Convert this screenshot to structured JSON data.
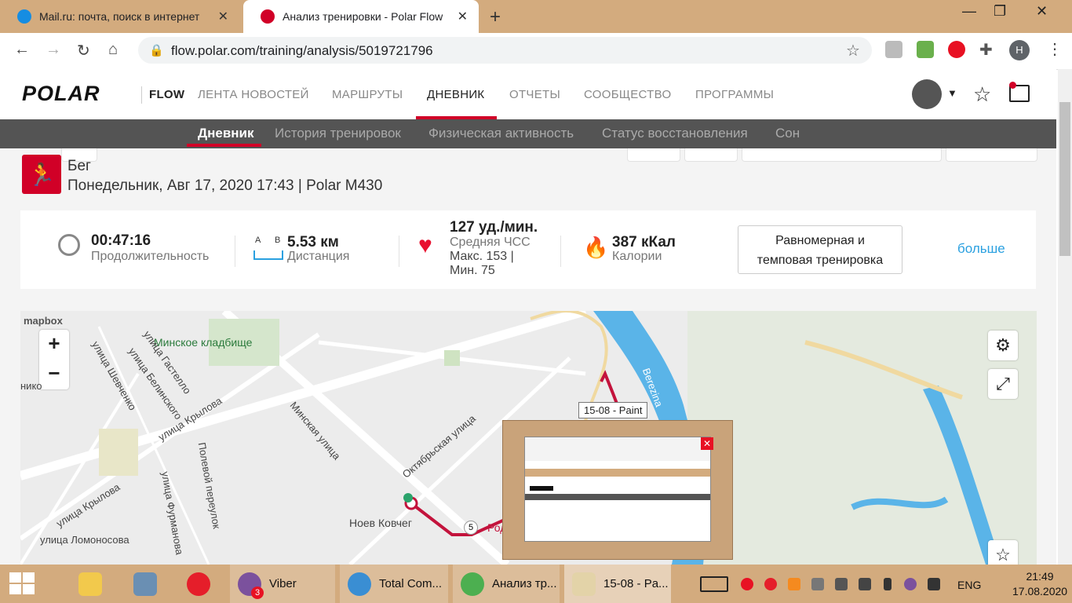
{
  "browser": {
    "tabs": [
      {
        "title": "Mail.ru: почта, поиск в интернет",
        "active": false
      },
      {
        "title": "Анализ тренировки - Polar Flow",
        "active": true
      }
    ],
    "url": "flow.polar.com/training/analysis/5019721796",
    "profile_initial": "Н"
  },
  "polar": {
    "logo": "POLAR",
    "nav": [
      "FLOW",
      "ЛЕНТА НОВОСТЕЙ",
      "МАРШРУТЫ",
      "ДНЕВНИК",
      "ОТЧЕТЫ",
      "СООБЩЕСТВО",
      "ПРОГРАММЫ"
    ],
    "active_nav": "ДНЕВНИК",
    "subnav": [
      "Дневник",
      "История тренировок",
      "Физическая активность",
      "Статус восстановления",
      "Сон"
    ],
    "active_subnav": "Дневник"
  },
  "session": {
    "sport": "Бег",
    "date_line": "Понедельник, Авг 17, 2020 17:43 | Polar M430"
  },
  "stats": {
    "duration_value": "00:47:16",
    "duration_label": "Продолжительность",
    "distance_a": "A",
    "distance_b": "B",
    "distance_value": "5.53 км",
    "distance_label": "Дистанция",
    "hr_value": "127 уд./мин.",
    "hr_label": "Средняя ЧСС",
    "hr_max": "Макс. 153  |",
    "hr_min": "Мин. 75",
    "cal_value": "387 кКал",
    "cal_label": "Калории",
    "type_line1": "Равномерная и",
    "type_line2": "темповая тренировка",
    "more": "больше"
  },
  "map": {
    "attribution": "mapbox",
    "zoom_in": "+",
    "zoom_out": "−",
    "labels": {
      "cemetery": "Минское кладбище",
      "street_krylova": "улица Крылова",
      "street_krylova2": "улица Крылова",
      "street_minskaya": "Минская улица",
      "street_oktyabrskaya": "Октябрьская улица",
      "street_shevchenko": "улица Шевченко",
      "street_gastello": "улица Гастелло",
      "street_belinskogo": "улица Белинского",
      "street_lomonosova": "улица Ломоносова",
      "street_furmanova": "улица Фурманова",
      "polevoy": "Полевой переулок",
      "noev": "Ноев Ковчег",
      "river": "Berezina",
      "km5": "5",
      "partial_nik": "нико",
      "partial_rod": "Род"
    }
  },
  "paint_tooltip": "15-08 - Paint",
  "taskbar": {
    "items": [
      "Viber",
      "Total Com...",
      "Анализ тр...",
      "15-08 - Pa..."
    ],
    "viber_badge": "3",
    "lang": "ENG",
    "time": "21:49",
    "date": "17.08.2020"
  }
}
